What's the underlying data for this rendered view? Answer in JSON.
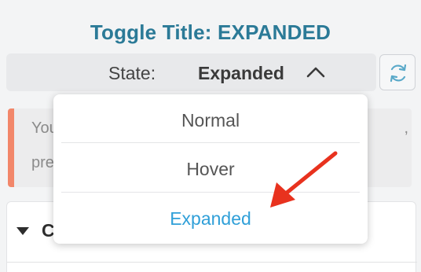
{
  "title": "Toggle Title: EXPANDED",
  "state_bar": {
    "label": "State:",
    "value": "Expanded"
  },
  "dropdown": {
    "options": [
      "Normal",
      "Hover",
      "Expanded"
    ],
    "selected": "Expanded"
  },
  "notice": {
    "line1_start": "You",
    "line1_end": ",",
    "line2_start": "pre"
  },
  "panel": {
    "title_fragment": "C"
  },
  "colors": {
    "title": "#2b7a97",
    "selected_option": "#2f9fd8",
    "notice_accent": "#f2876a",
    "annotation_arrow": "#e8321e"
  },
  "icons": {
    "caret": "chevron-up-icon",
    "refresh": "refresh-icon",
    "panel_toggle": "triangle-down-icon",
    "annotation": "red-arrow-icon"
  }
}
